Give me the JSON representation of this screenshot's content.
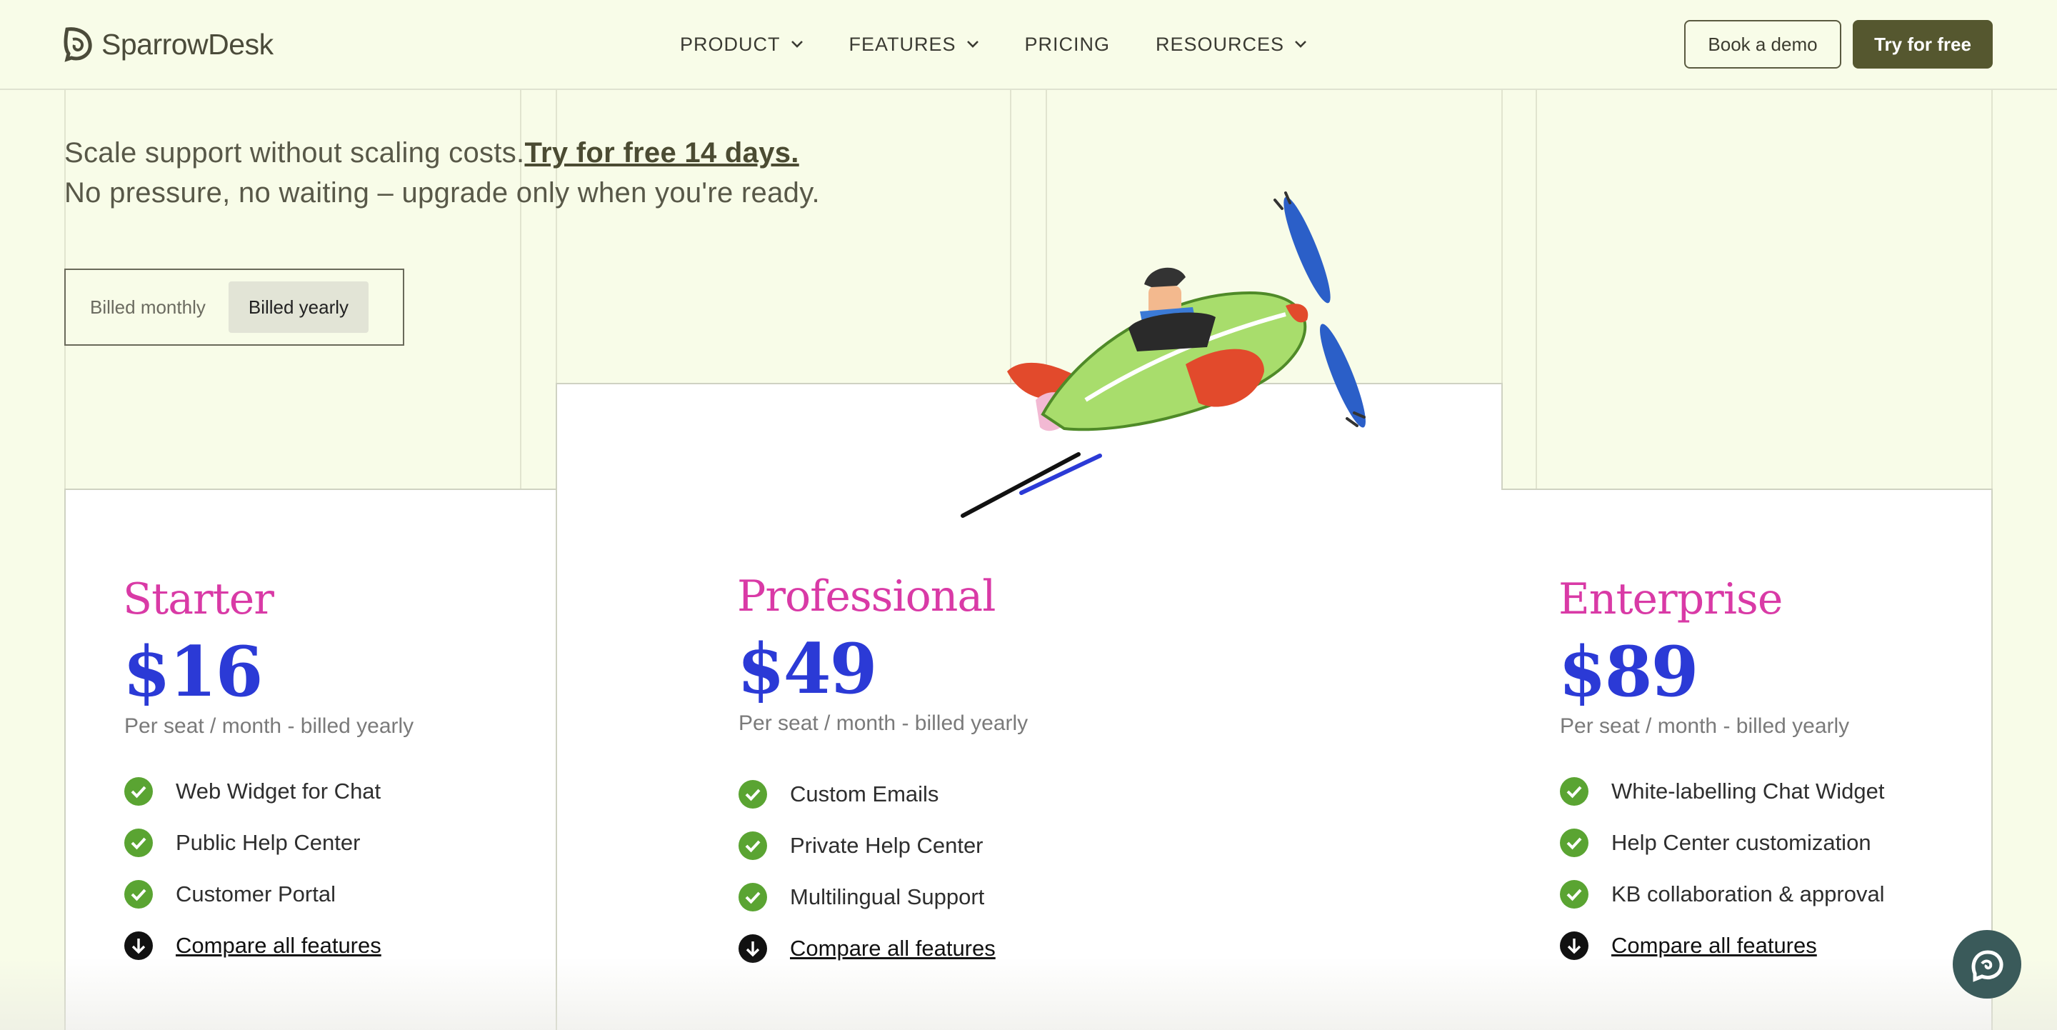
{
  "brand": {
    "name": "SparrowDesk"
  },
  "nav": {
    "items": [
      {
        "label": "PRODUCT",
        "has_dropdown": true
      },
      {
        "label": "FEATURES",
        "has_dropdown": true
      },
      {
        "label": "PRICING",
        "has_dropdown": false
      },
      {
        "label": "RESOURCES",
        "has_dropdown": true
      }
    ],
    "book_demo": "Book a demo",
    "try_free": "Try for free"
  },
  "hero": {
    "line1": "Scale support without scaling costs.",
    "trial_link": "Try for free 14 days.",
    "line2": "No pressure, no waiting – upgrade only when you're ready."
  },
  "billing_toggle": {
    "options": [
      "Billed monthly",
      "Billed yearly"
    ],
    "selected": "Billed yearly"
  },
  "plans": [
    {
      "name": "Starter",
      "price": "$16",
      "note": "Per seat / month - billed yearly",
      "features": [
        "Web Widget for Chat",
        "Public Help Center",
        "Customer Portal"
      ],
      "compare": "Compare all features"
    },
    {
      "name": "Professional",
      "price": "$49",
      "note": "Per seat / month - billed yearly",
      "features": [
        "Custom Emails",
        "Private Help Center",
        "Multilingual Support"
      ],
      "compare": "Compare all features"
    },
    {
      "name": "Enterprise",
      "price": "$89",
      "note": "Per seat / month - billed yearly",
      "features": [
        "White-labelling Chat Widget",
        "Help Center customization",
        "KB collaboration & approval"
      ],
      "compare": "Compare all features"
    }
  ],
  "colors": {
    "background": "#f8fce8",
    "accent_dark": "#55572f",
    "plan_name": "#d93aa6",
    "price": "#2b3ad6",
    "check": "#5aa432"
  },
  "icons": {
    "dropdown": "chevron-down-icon",
    "feature": "check-circle-icon",
    "compare": "arrow-down-circle-icon",
    "chat": "chat-bubble-icon",
    "illustration": "airplane-illustration"
  }
}
